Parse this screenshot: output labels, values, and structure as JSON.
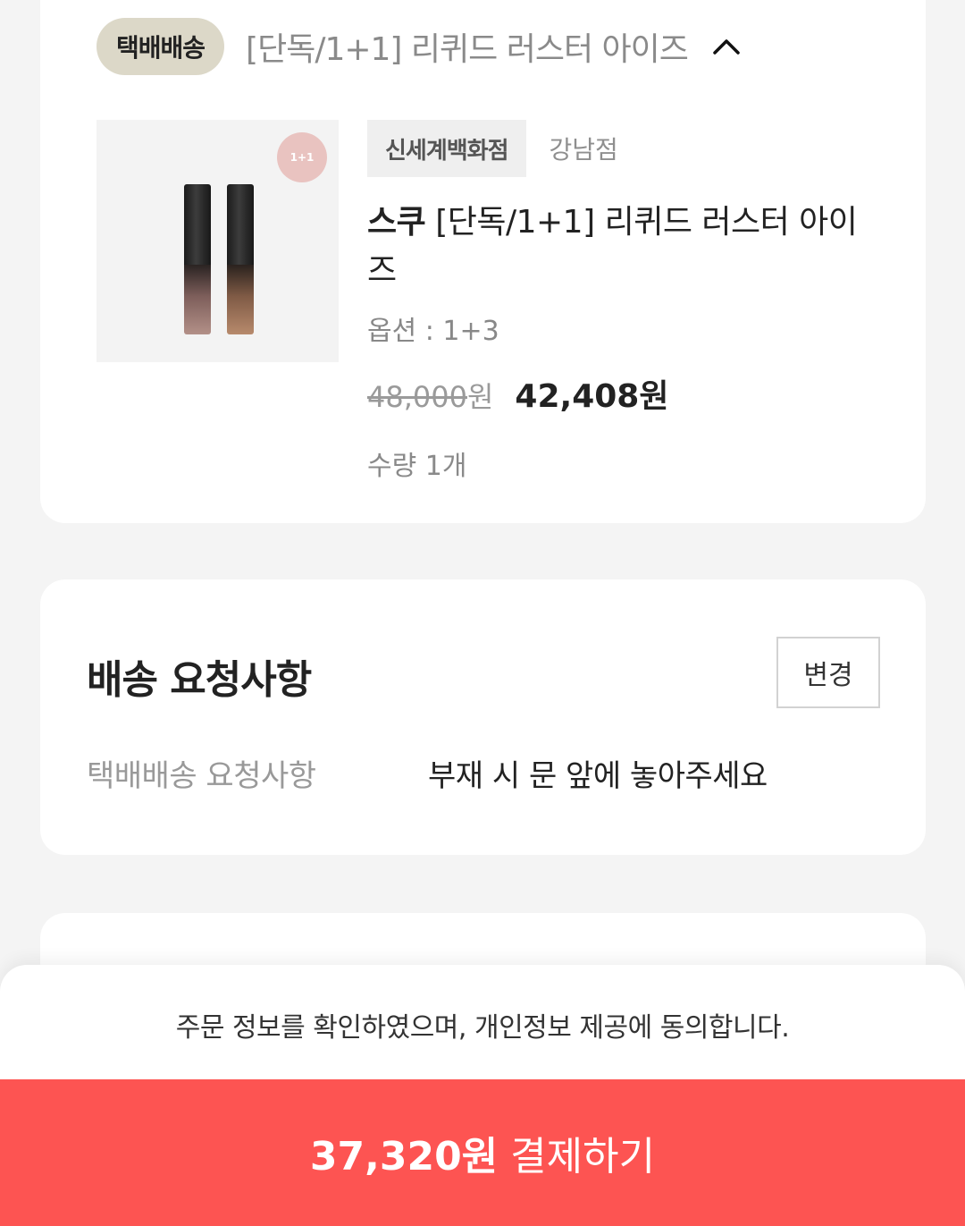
{
  "product_section": {
    "shipping_badge": "택배배송",
    "group_title": "[단독/1+1] 리퀴드 러스터 아이즈",
    "collapse_icon": "chevron-up-icon",
    "item": {
      "image_badge": "1+1",
      "store": "신세계백화점",
      "branch": "강남점",
      "brand": "스쿠",
      "name": "[단독/1+1] 리퀴드 러스터 아이즈",
      "option": "옵션 : 1+3",
      "original_price": "48,000",
      "original_price_unit": "원",
      "sale_price": "42,408원",
      "quantity": "수량 1개"
    }
  },
  "delivery_request": {
    "title": "배송 요청사항",
    "change_button": "변경",
    "label": "택배배송 요청사항",
    "value": "부재 시 문 앞에 놓아주세요"
  },
  "checkout": {
    "agreement": "주문 정보를 확인하였으며, 개인정보 제공에 동의합니다.",
    "pay_amount": "37,320원",
    "pay_label": "결제하기",
    "pay_color": "#fd5452"
  }
}
